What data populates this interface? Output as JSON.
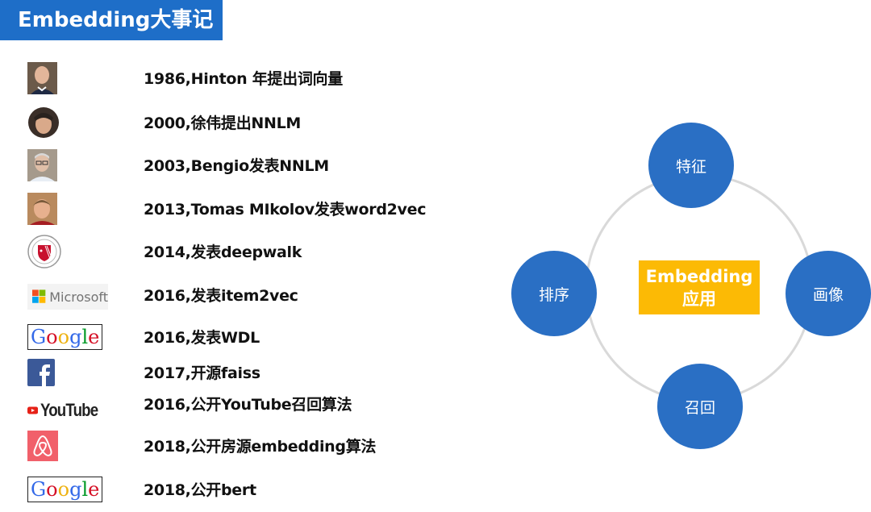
{
  "header": {
    "title": "Embedding大事记"
  },
  "timeline": [
    {
      "logo": "hinton-photo",
      "text": "1986,Hinton 年提出词向量"
    },
    {
      "logo": "xu-wei-photo",
      "text": "2000,徐伟提出NNLM"
    },
    {
      "logo": "bengio-photo",
      "text": "2003,Bengio发表NNLM"
    },
    {
      "logo": "mikolov-photo",
      "text": "2013,Tomas MIkolov发表word2vec"
    },
    {
      "logo": "stony-brook-logo",
      "text": "2014,发表deepwalk"
    },
    {
      "logo": "microsoft-logo",
      "text": "2016,发表item2vec",
      "logo_text": "Microsoft"
    },
    {
      "logo": "google-logo",
      "text": "2016,发表WDL",
      "logo_text": "Google"
    },
    {
      "logo": "facebook-logo",
      "text": "2017,开源faiss",
      "logo_text": "f"
    },
    {
      "logo": "youtube-logo",
      "text": "2016,公开YouTube召回算法",
      "logo_text": "YouTube"
    },
    {
      "logo": "airbnb-logo",
      "text": "2018,公开房源embedding算法"
    },
    {
      "logo": "google-logo",
      "text": "2018,公开bert",
      "logo_text": "Google"
    }
  ],
  "diagram": {
    "center_line1": "Embedding",
    "center_line2": "应用",
    "nodes": {
      "top": "特征",
      "right": "画像",
      "bottom": "召回",
      "left": "排序"
    }
  },
  "colors": {
    "title_bg": "#1E6EC8",
    "node": "#2A6FC4",
    "center": "#FCBA05",
    "ring": "#D9D9D9"
  }
}
